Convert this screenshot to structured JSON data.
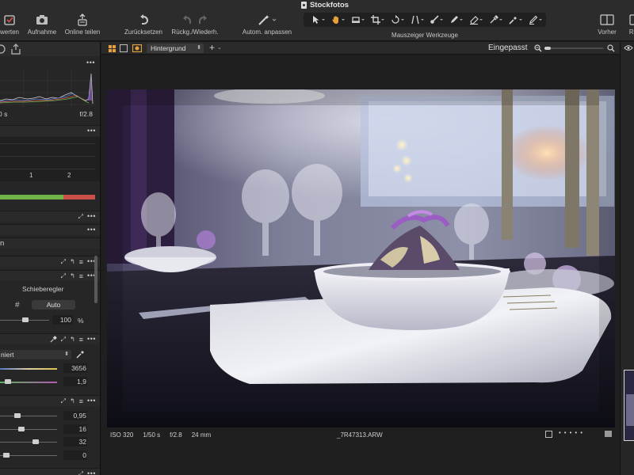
{
  "window": {
    "title": "Stockfotos"
  },
  "toolbar": {
    "import_label": "werten",
    "capture_label": "Aufnahme",
    "share_label": "Online teilen",
    "reset_label": "Zurücksetzen",
    "undo_redo_label": "Rückg./Wiederh.",
    "auto_adjust_label": "Autom. anpassen",
    "cursor_tools_label": "Mauszeiger Werkzeuge",
    "viewer_label": "Vorher",
    "right_cut_label": "Ra"
  },
  "left_panel": {
    "histogram": {
      "shutter": "0 s",
      "aperture": "f/2.8"
    },
    "exposure_scale": {
      "tick1": "1",
      "tick2": "2"
    },
    "layer_label": "n",
    "tool": {
      "mode_label": "Schieberegler",
      "auto_button": "Auto",
      "percent_value": "100",
      "percent_unit": "%"
    },
    "white_balance": {
      "mode_value": "niert",
      "kelvin_value": "3656",
      "tint_value": "1,9"
    },
    "adjustments": {
      "v1": "0,95",
      "v2": "16",
      "v3": "32",
      "v4": "0"
    }
  },
  "viewer": {
    "layer_select": "Hintergrund",
    "zoom_label": "Eingepasst",
    "zoom_fraction": 0.1,
    "info": {
      "iso": "ISO 320",
      "shutter": "1/50 s",
      "aperture": "f/2.8",
      "focal": "24 mm",
      "filename": "_7R47313.ARW"
    }
  },
  "colors": {
    "accent": "#e8a13a",
    "panel": "#262626",
    "toolbar": "#2c2c2c"
  }
}
